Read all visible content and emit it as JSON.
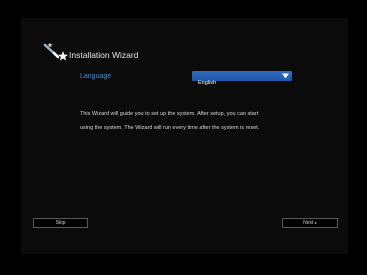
{
  "wizard": {
    "title": "Installation Wizard",
    "icon": "magic-wand-icon"
  },
  "language": {
    "label": "Language",
    "selected": "English"
  },
  "description": {
    "line1": "This Wizard will guide you to set up the system. After setup, you can start",
    "line2": "using the system. The Wizard will run every time after the system is reset."
  },
  "buttons": {
    "skip_label": "Skip",
    "next_label": "Next",
    "next_arrow": "▸"
  },
  "colors": {
    "background": "#000000",
    "accent": "#4f88c6",
    "select_blue": "#1d56a8",
    "text": "#d8d8d8"
  }
}
